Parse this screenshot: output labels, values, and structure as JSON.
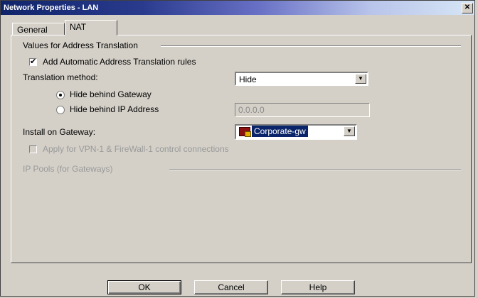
{
  "window": {
    "title": "Network Properties - LAN",
    "close_glyph": "✕"
  },
  "tabs": [
    {
      "label": "General"
    },
    {
      "label": "NAT"
    }
  ],
  "nat": {
    "group_title": "Values for Address Translation",
    "auto_rules_label": "Add Automatic Address Translation rules",
    "auto_rules_checked": true,
    "translation_method_label": "Translation method:",
    "translation_method_value": "Hide",
    "hide_gateway_label": "Hide behind Gateway",
    "hide_ip_label": "Hide behind IP Address",
    "selected_option": "Hide behind Gateway",
    "ip_value": "0.0.0.0",
    "install_gateway_label": "Install on Gateway:",
    "install_gateway_value": "Corporate-gw",
    "apply_vpn_label": "Apply for VPN-1 & FireWall-1 control connections",
    "apply_vpn_checked": false,
    "ip_pools_title": "IP Pools (for Gateways)"
  },
  "buttons": {
    "ok": "OK",
    "cancel": "Cancel",
    "help": "Help"
  },
  "icons": {
    "checkmark": "✔",
    "dropdown_arrow": "▼",
    "gateway": "gateway-icon"
  }
}
